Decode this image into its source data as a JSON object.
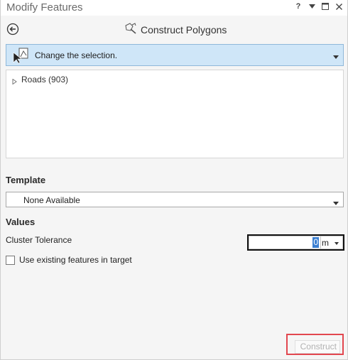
{
  "window": {
    "title": "Modify Features",
    "help_label": "?",
    "icons": [
      "help-icon",
      "pin-icon",
      "maximize-icon",
      "close-icon"
    ]
  },
  "header": {
    "tool_title": "Construct Polygons",
    "icons": [
      "back-arrow-icon",
      "construct-polygons-icon"
    ]
  },
  "selection": {
    "label": "Change the selection.",
    "icon": "select-features-icon"
  },
  "feature_list": {
    "items": [
      {
        "label": "Roads (903)",
        "expanded": false
      }
    ]
  },
  "template": {
    "heading": "Template",
    "selected": "None Available"
  },
  "values": {
    "heading": "Values",
    "cluster_tolerance": {
      "label": "Cluster Tolerance",
      "value": "0",
      "unit": "m"
    },
    "use_existing": {
      "label": "Use existing features in target",
      "checked": false
    }
  },
  "actions": {
    "construct_label": "Construct",
    "construct_enabled": false
  },
  "colors": {
    "selection_bar": "#cfe6f8",
    "highlight": "#3b7fd1",
    "annotation_red": "#e2474f"
  }
}
